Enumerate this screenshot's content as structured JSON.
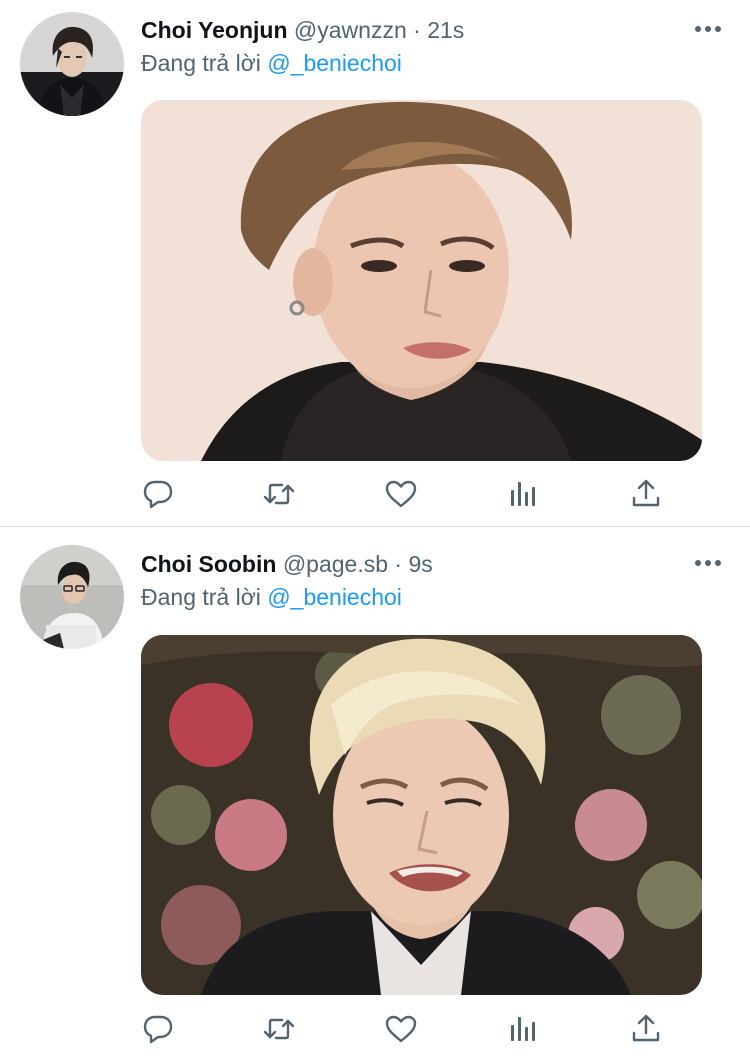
{
  "tweets": [
    {
      "display_name": "Choi Yeonjun",
      "handle": "@yawnzzn",
      "separator": "·",
      "time": "21s",
      "reply_prefix": "Đang trả lời",
      "reply_to": "@_beniechoi",
      "avatar_icon": "avatar-photo",
      "media_icon": "photo-man-squinting-beige-background",
      "actions": [
        "reply-icon",
        "retweet-icon",
        "like-icon",
        "analytics-icon",
        "share-icon"
      ]
    },
    {
      "display_name": "Choi Soobin",
      "handle": "@page.sb",
      "separator": "·",
      "time": "9s",
      "reply_prefix": "Đang trả lời",
      "reply_to": "@_beniechoi",
      "avatar_icon": "avatar-photo",
      "media_icon": "photo-blond-man-grimacing-flower-background",
      "actions": [
        "reply-icon",
        "retweet-icon",
        "like-icon",
        "analytics-icon",
        "share-icon"
      ]
    }
  ],
  "colors": {
    "text": "#0f1419",
    "secondary": "#536471",
    "mention": "#1d9bf0",
    "divider": "#e1e5e8"
  }
}
